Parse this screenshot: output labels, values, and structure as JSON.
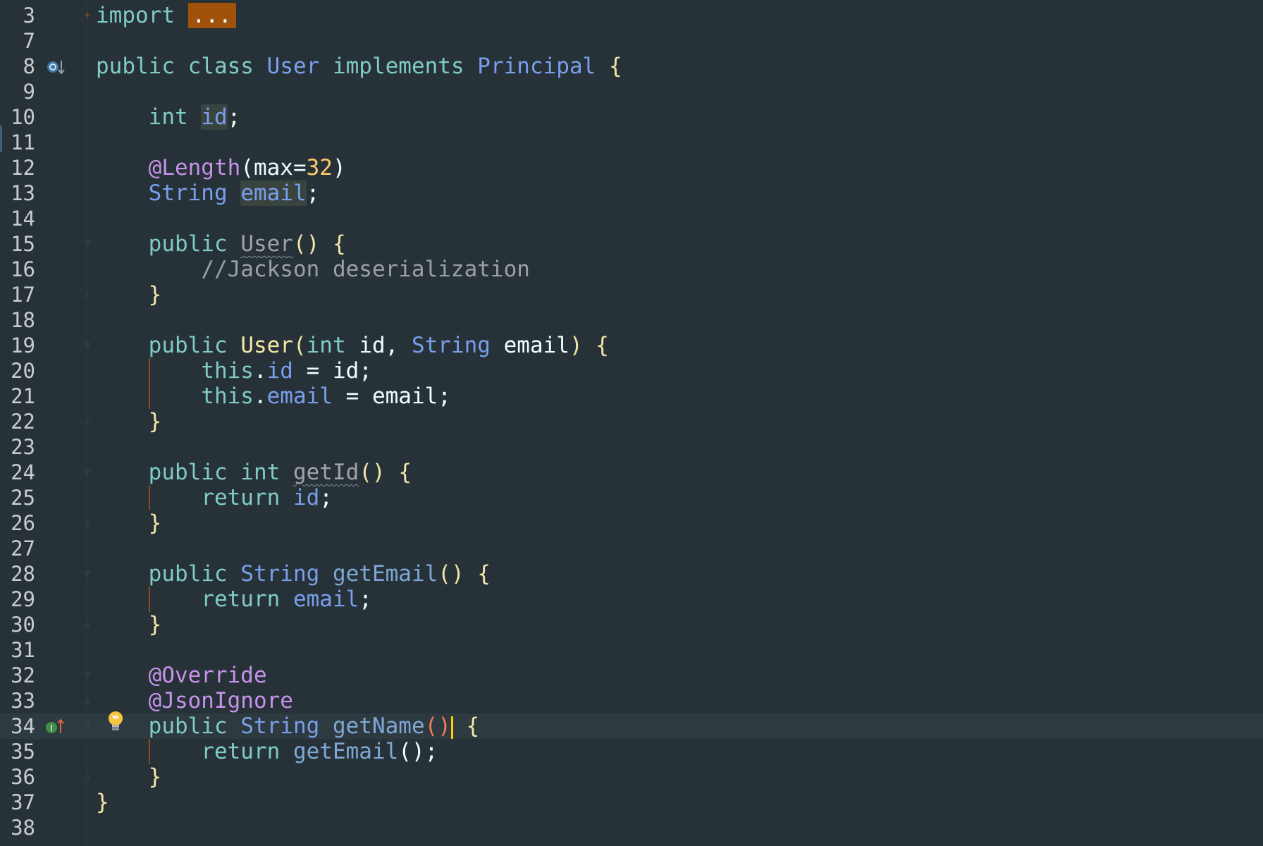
{
  "editor": {
    "lines": [
      {
        "num": "3"
      },
      {
        "num": "7"
      },
      {
        "num": "8"
      },
      {
        "num": "9"
      },
      {
        "num": "10"
      },
      {
        "num": "11"
      },
      {
        "num": "12"
      },
      {
        "num": "13"
      },
      {
        "num": "14"
      },
      {
        "num": "15"
      },
      {
        "num": "16"
      },
      {
        "num": "17"
      },
      {
        "num": "18"
      },
      {
        "num": "19"
      },
      {
        "num": "20"
      },
      {
        "num": "21"
      },
      {
        "num": "22"
      },
      {
        "num": "23"
      },
      {
        "num": "24"
      },
      {
        "num": "25"
      },
      {
        "num": "26"
      },
      {
        "num": "27"
      },
      {
        "num": "28"
      },
      {
        "num": "29"
      },
      {
        "num": "30"
      },
      {
        "num": "31"
      },
      {
        "num": "32"
      },
      {
        "num": "33"
      },
      {
        "num": "34"
      },
      {
        "num": "35"
      },
      {
        "num": "36"
      },
      {
        "num": "37"
      },
      {
        "num": "38"
      }
    ],
    "tokens": {
      "import_kw": "import",
      "fold_dots": "...",
      "public": "public",
      "class": "class",
      "implements": "implements",
      "class_name": "User",
      "principal": "Principal",
      "open_brace": "{",
      "close_brace": "}",
      "int": "int",
      "id": "id",
      "semicolon": ";",
      "length_ann": "@Length",
      "max_open": "(max=",
      "max_val": "32",
      "close_paren": ")",
      "string": "String",
      "email": "email",
      "parens": "()",
      "comment": "//Jackson deserialization",
      "ctor_sig_open": "(",
      "comma_space": ", ",
      "this": "this",
      "dot": ".",
      "assign": " = ",
      "return": "return",
      "get_id": "getId",
      "get_email": "getEmail",
      "override": "@Override",
      "json_ignore": "@JsonIgnore",
      "get_name": "getName",
      "open_paren": "(",
      "call_end": "();"
    },
    "icons": {
      "line8": "implemented-interface-icon",
      "line34": "overrides-method-icon",
      "line34_bulb": "lightbulb-icon"
    },
    "colors": {
      "background": "#263238",
      "keyword": "#80cbc4",
      "type": "#82aaff",
      "annotation": "#c792ea",
      "number": "#ffcb6b",
      "comment": "#9aa1a6",
      "caret": "#ffcc00"
    }
  }
}
